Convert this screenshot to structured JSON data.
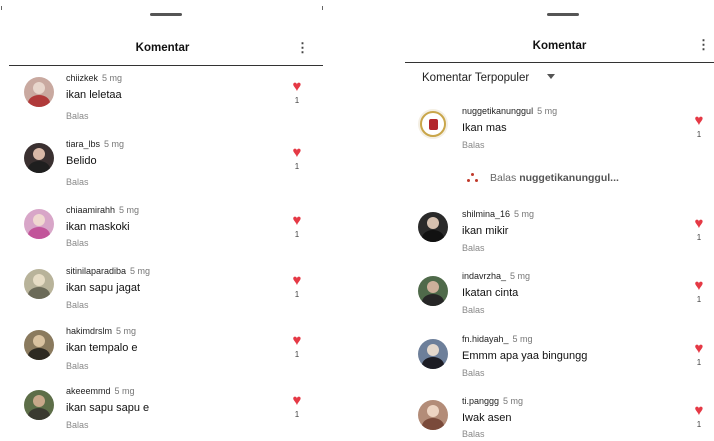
{
  "left_panel": {
    "title": "Komentar",
    "more_icon": "more-vertical-icon",
    "comments": [
      {
        "username": "chiizkek",
        "time": "5 mg",
        "text": "ikan leletaa",
        "reply": "Balas",
        "likes": "1"
      },
      {
        "username": "tiara_lbs",
        "time": "5 mg",
        "text": "Belido",
        "reply": "Balas",
        "likes": "1"
      },
      {
        "username": "chiaamirahh",
        "time": "5 mg",
        "text": "ikan maskoki",
        "reply": "Balas",
        "likes": "1"
      },
      {
        "username": "sitinilaparadiba",
        "time": "5 mg",
        "text": "ikan sapu jagat",
        "reply": "Balas",
        "likes": "1"
      },
      {
        "username": "hakimdrslm",
        "time": "5 mg",
        "text": "ikan tempalo e",
        "reply": "Balas",
        "likes": "1"
      },
      {
        "username": "akeeemmd",
        "time": "5 mg",
        "text": "ikan sapu sapu e",
        "reply": "Balas",
        "likes": "1"
      }
    ]
  },
  "right_panel": {
    "title": "Komentar",
    "more_icon": "more-vertical-icon",
    "sort_label": "Komentar Terpopuler",
    "view_replies": {
      "label": "Balas",
      "username": "nuggetikanunggul..."
    },
    "comments": [
      {
        "username": "nuggetikanunggul",
        "time": "5 mg",
        "text": "Ikan mas",
        "reply": "Balas",
        "likes": "1"
      },
      {
        "username": "shilmina_16",
        "time": "5 mg",
        "text": "ikan mikir",
        "reply": "Balas",
        "likes": "1"
      },
      {
        "username": "indavrzha_",
        "time": "5 mg",
        "text": "Ikatan cinta",
        "reply": "Balas",
        "likes": "1"
      },
      {
        "username": "fn.hidayah_",
        "time": "5 mg",
        "text": "Emmm apa yaa bingungg",
        "reply": "Balas",
        "likes": "1"
      },
      {
        "username": "ti.panggg",
        "time": "5 mg",
        "text": "Iwak asen",
        "reply": "Balas",
        "likes": "1"
      }
    ]
  },
  "colors": {
    "heart": "#e53945",
    "divider": "#333333",
    "muted": "#888888"
  }
}
